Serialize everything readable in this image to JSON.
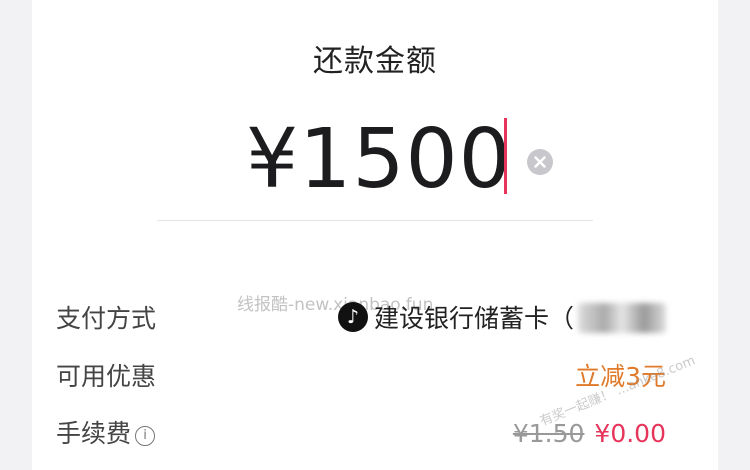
{
  "title": "还款金额",
  "amount": "¥1500",
  "watermark": "线报酷-new.xianbao.fun",
  "corner_watermark": "有奖一起赚！ ...anke8.com",
  "rows": {
    "payment": {
      "label": "支付方式",
      "value": "建设银行储蓄卡（"
    },
    "discount": {
      "label": "可用优惠",
      "value": "立减3元"
    },
    "fee": {
      "label": "手续费",
      "old": "¥1.50",
      "new": "¥0.00"
    }
  },
  "colors": {
    "accent": "#e6345a",
    "discount": "#e07a2a"
  },
  "icons": [
    "clear-icon",
    "tiktok-icon",
    "info-icon"
  ]
}
